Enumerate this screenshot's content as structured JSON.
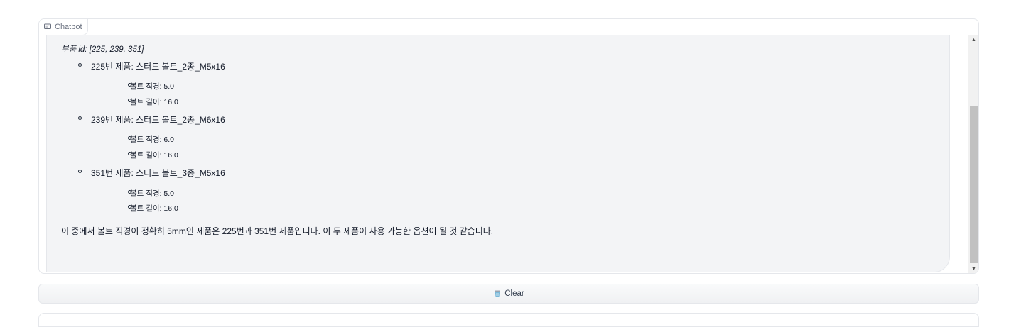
{
  "chatbot": {
    "label": "Chatbot",
    "label_icon": "chat-bubble-icon",
    "message": {
      "parts_id": "부품 id: [225, 239, 351]",
      "products": [
        {
          "title": "225번 제품: 스터드 볼트_2종_M5x16",
          "specs": [
            "볼트 직경: 5.0",
            "볼트 길이: 16.0"
          ]
        },
        {
          "title": "239번 제품: 스터드 볼트_2종_M6x16",
          "specs": [
            "볼트 직경: 6.0",
            "볼트 길이: 16.0"
          ]
        },
        {
          "title": "351번 제품: 스터드 볼트_3종_M5x16",
          "specs": [
            "볼트 직경: 5.0",
            "볼트 길이: 16.0"
          ]
        }
      ],
      "conclusion": "이 중에서 볼트 직경이 정확히 5mm인 제품은 225번과 351번 제품입니다. 이 두 제품이 사용 가능한 옵션이 될 것 같습니다."
    },
    "scrollbar": {
      "up_glyph": "▲",
      "down_glyph": "▼"
    }
  },
  "clear_button": {
    "label": "Clear",
    "icon": "trash-icon",
    "icon_color": "#7ab8d8"
  }
}
